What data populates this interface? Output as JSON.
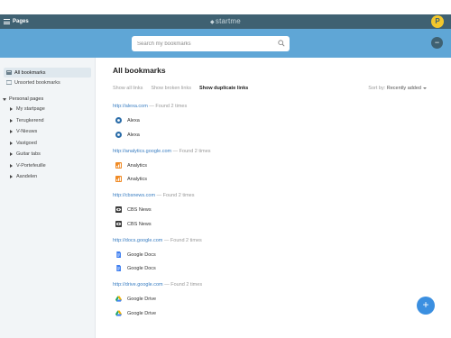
{
  "topbar": {
    "pages_label": "Pages",
    "brand": "startme",
    "user_initial": "P"
  },
  "search": {
    "placeholder": "Search my bookmarks"
  },
  "sidebar": {
    "all_bookmarks": "All bookmarks",
    "unsorted_bookmarks": "Unsorted bookmarks",
    "personal_pages_heading": "Personal pages",
    "pages": [
      "My startpage",
      "Terugkerend",
      "V-Nieuws",
      "Vastgoed",
      "Guitar tabs",
      "V-Portefeuille",
      "Aandelen"
    ]
  },
  "main": {
    "title": "All bookmarks",
    "tabs": [
      "Show all links",
      "Show broken links",
      "Show duplicate links"
    ],
    "sort_label": "Sort by:",
    "sort_value": "Recently added",
    "found_text": "— Found 2 times",
    "groups": [
      {
        "url": "http://alexa.com",
        "name": "Alexa",
        "icon": "alexa-icon"
      },
      {
        "url": "http://analytics.google.com",
        "name": "Analytics",
        "icon": "analytics-icon"
      },
      {
        "url": "http://cbsnews.com",
        "name": "CBS News",
        "icon": "cbs-news-icon"
      },
      {
        "url": "http://docs.google.com",
        "name": "Google Docs",
        "icon": "google-docs-icon"
      },
      {
        "url": "http://drive.google.com",
        "name": "Google Drive",
        "icon": "google-drive-icon"
      }
    ]
  },
  "colors": {
    "topbar": "#3f6172",
    "search_band": "#5fa6d6",
    "link": "#3a7ec2",
    "fab": "#3b8fe0"
  },
  "fab_icon": "+"
}
